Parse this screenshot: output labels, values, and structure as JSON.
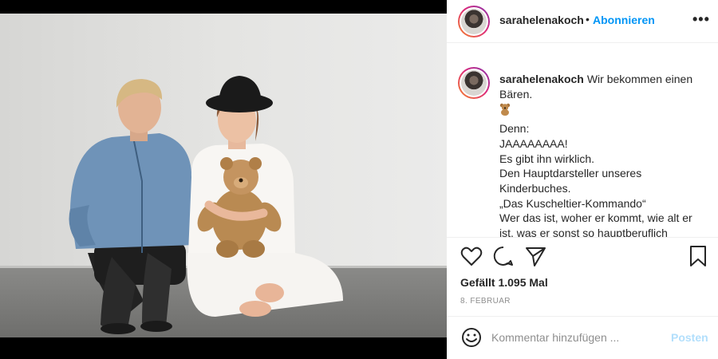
{
  "post": {
    "username": "sarahelenakoch",
    "separator": "•",
    "follow_label": "Abonnieren",
    "more_label": "•••",
    "caption_first": "Wir bekommen einen Bären.",
    "caption_lines": [
      "Denn:",
      "JAAAAAAAA!",
      "Es gibt ihn wirklich.",
      "Den Hauptdarsteller unseres Kinderbuches.",
      "„Das Kuscheltier-Kommando“",
      "Wer das ist, woher er kommt, wie alt er ist, was er sonst so hauptberuflich"
    ],
    "emoji_icon": "teddy-bear-emoji",
    "likes": "Gefällt 1.095 Mal",
    "date": "8. FEBRUAR"
  },
  "comment": {
    "placeholder": "Kommentar hinzufügen ...",
    "post_label": "Posten"
  },
  "icons": [
    "heart-icon",
    "comment-icon",
    "share-icon",
    "bookmark-icon",
    "smiley-icon",
    "more-options-icon"
  ],
  "colors": {
    "accent": "#0095f6",
    "post_disabled": "#b2dffc",
    "muted_text": "#8e8e8e",
    "border": "#efefef"
  }
}
